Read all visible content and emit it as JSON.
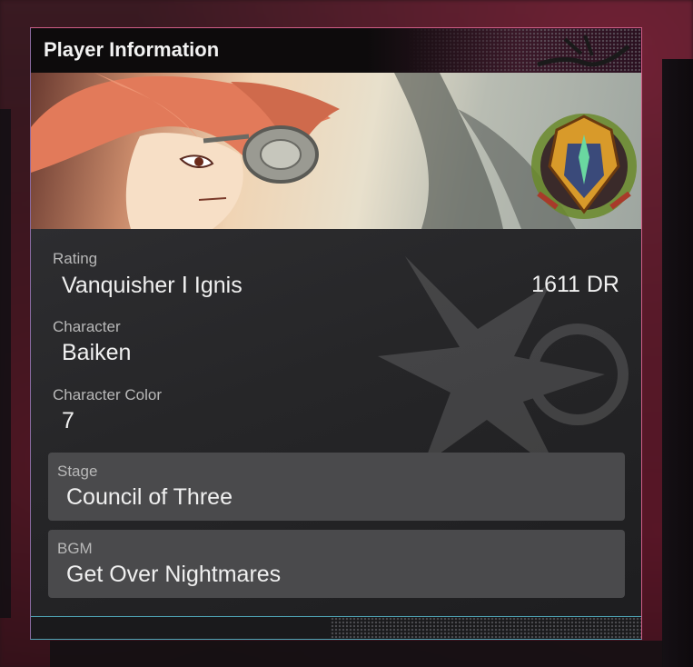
{
  "panel": {
    "title": "Player Information"
  },
  "fields": {
    "rating_label": "Rating",
    "rating_value": "Vanquisher Ⅰ Ignis",
    "rating_points": "1611 DR",
    "character_label": "Character",
    "character_value": "Baiken",
    "color_label": "Character Color",
    "color_value": "7"
  },
  "stage": {
    "label": "Stage",
    "value": "Council of Three"
  },
  "bgm": {
    "label": "BGM",
    "value": "Get Over Nightmares"
  },
  "icons": {
    "banner": "character-portrait",
    "rank_badge": "rank-emblem-icon"
  },
  "colors": {
    "border_top": "#cf5d86",
    "border_bottom": "#4fa6b7",
    "box_bg": "#4a4a4c"
  }
}
